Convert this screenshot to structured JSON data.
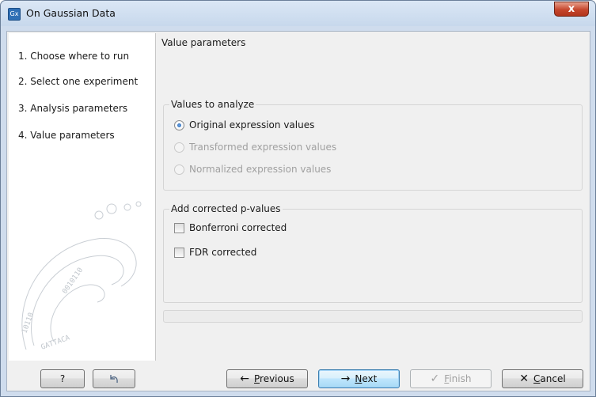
{
  "window": {
    "title": "On Gaussian Data",
    "app_icon_text": "Gx",
    "close_glyph": "x"
  },
  "steps": [
    {
      "label": "1.  Choose where to run"
    },
    {
      "label": "2.  Select one experiment"
    },
    {
      "label": "3.  Analysis parameters"
    },
    {
      "label": "4.  Value parameters"
    }
  ],
  "main": {
    "section_title": "Value parameters",
    "values_group": {
      "title": "Values to analyze",
      "options": [
        {
          "label": "Original expression values",
          "checked": true,
          "enabled": true
        },
        {
          "label": "Transformed expression values",
          "checked": false,
          "enabled": false
        },
        {
          "label": "Normalized expression values",
          "checked": false,
          "enabled": false
        }
      ]
    },
    "pvalues_group": {
      "title": "Add corrected p-values",
      "options": [
        {
          "label": "Bonferroni corrected",
          "checked": false
        },
        {
          "label": "FDR corrected",
          "checked": false
        }
      ]
    }
  },
  "footer": {
    "help_label": "?",
    "reset_icon": "undo-arrow-icon",
    "previous_label": "Previous",
    "previous_mnemonic": "P",
    "previous_rest": "revious",
    "next_mnemonic": "N",
    "next_rest": "ext",
    "finish_mnemonic": "F",
    "finish_rest": "inish",
    "cancel_mnemonic": "C",
    "cancel_rest": "ancel"
  },
  "colors": {
    "accent": "#1d5fae",
    "close_button": "#c5462d",
    "frame": "#cfdced"
  }
}
